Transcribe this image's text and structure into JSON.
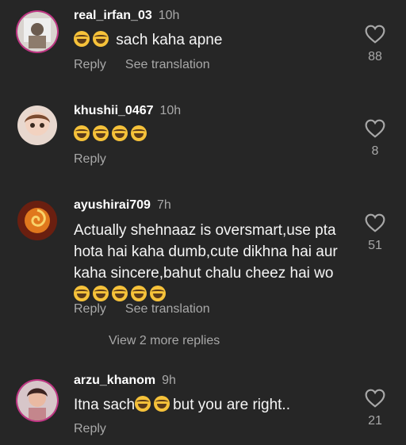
{
  "comments": [
    {
      "username": "real_irfan_03",
      "time": "10h",
      "text_suffix": "sach kaha apne",
      "emoji_count": 2,
      "reply_label": "Reply",
      "translation_label": "See translation",
      "likes": "88"
    },
    {
      "username": "khushii_0467",
      "time": "10h",
      "text_suffix": "",
      "emoji_count": 4,
      "reply_label": "Reply",
      "likes": "8"
    },
    {
      "username": "ayushirai709",
      "time": "7h",
      "text_main": "Actually shehnaaz is oversmart,use pta hota hai kaha dumb,cute dikhna hai aur kaha sincere,bahut chalu cheez hai wo",
      "emoji_count": 5,
      "reply_label": "Reply",
      "translation_label": "See translation",
      "likes": "51",
      "more_replies": "View 2 more replies"
    },
    {
      "username": "arzu_khanom",
      "time": "9h",
      "text_prefix": "Itna sach",
      "text_suffix": "but you are right..",
      "emoji_count": 2,
      "reply_label": "Reply",
      "likes": "21"
    }
  ],
  "icons": {
    "like": "heart-outline-icon",
    "emoji": "face-with-tears-of-joy-icon"
  },
  "colors": {
    "background": "#262626",
    "secondary_text": "#a8a8a8",
    "story_ring": "#c13584",
    "emoji": "#f6c23a"
  }
}
